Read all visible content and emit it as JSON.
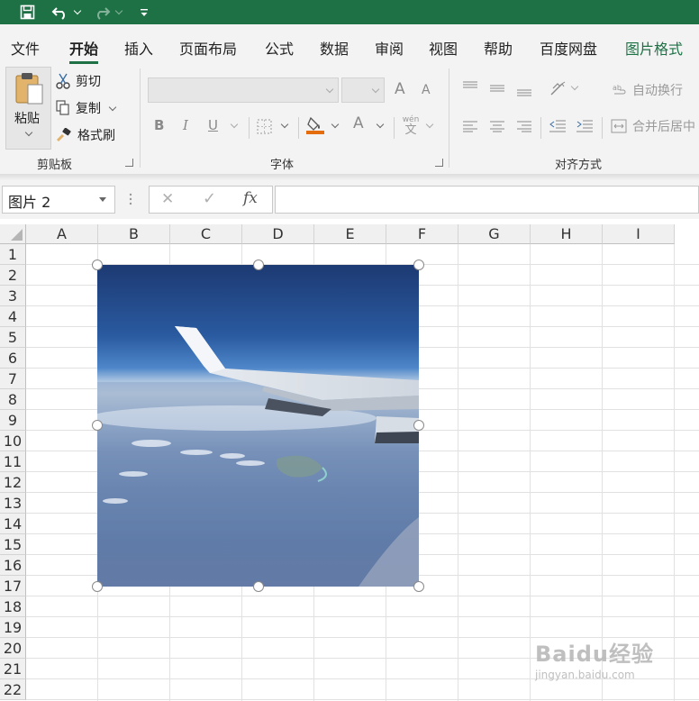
{
  "qat": {
    "save_icon": "save-icon",
    "undo_icon": "undo-icon",
    "redo_icon": "redo-icon",
    "customize_icon": "customize-qat-icon",
    "bar_color": "#1e7145"
  },
  "tabs": [
    {
      "label": "文件"
    },
    {
      "label": "开始"
    },
    {
      "label": "插入"
    },
    {
      "label": "页面布局"
    },
    {
      "label": "公式"
    },
    {
      "label": "数据"
    },
    {
      "label": "审阅"
    },
    {
      "label": "视图"
    },
    {
      "label": "帮助"
    },
    {
      "label": "百度网盘"
    },
    {
      "label": "图片格式"
    }
  ],
  "active_tab": "开始",
  "ribbon": {
    "clipboard": {
      "paste_label": "粘贴",
      "cut_label": "剪切",
      "copy_label": "复制",
      "format_painter_label": "格式刷",
      "group_label": "剪贴板"
    },
    "font": {
      "font_name": "",
      "font_size": "",
      "bold": "B",
      "italic": "I",
      "underline": "U",
      "grow": "A",
      "shrink": "A",
      "font_color": "A",
      "phonetic_top": "wén",
      "phonetic_bottom": "文",
      "group_label": "字体",
      "fill_color": "#e46c0a"
    },
    "alignment": {
      "wrap_label": "自动换行",
      "merge_label": "合并后居中",
      "group_label": "对齐方式"
    }
  },
  "formula_bar": {
    "name_box": "图片 2",
    "cancel": "✕",
    "enter": "✓",
    "fx": "fx",
    "formula": ""
  },
  "sheet": {
    "columns": [
      "A",
      "B",
      "C",
      "D",
      "E",
      "F",
      "G",
      "H",
      "I"
    ],
    "rows": [
      "1",
      "2",
      "3",
      "4",
      "5",
      "6",
      "7",
      "8",
      "9",
      "10",
      "11",
      "12",
      "13",
      "14",
      "15",
      "16",
      "17",
      "18",
      "19",
      "20",
      "21",
      "22"
    ]
  },
  "picture": {
    "description_icon": "airplane-wing-photo",
    "selected": true
  },
  "watermark": {
    "brand": "Baidu经验",
    "url": "jingyan.baidu.com"
  }
}
